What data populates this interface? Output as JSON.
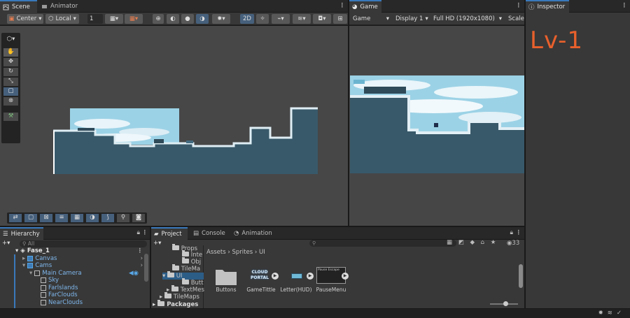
{
  "scene_window": {
    "tabs": [
      {
        "label": "Scene",
        "active": true
      },
      {
        "label": "Animator",
        "active": false
      }
    ],
    "toolbar": {
      "pivot": "Center",
      "space": "Local",
      "grid_value": "1",
      "mode_2d": "2D"
    }
  },
  "game_window": {
    "tab": "Game",
    "display_select": "Game",
    "display": "Display 1",
    "resolution": "Full HD (1920x1080)",
    "scale": "Scale"
  },
  "inspector": {
    "tab": "Inspector",
    "handwritten_note": "Lv-1"
  },
  "hierarchy": {
    "tab": "Hierarchy",
    "search_placeholder": "All",
    "items": [
      {
        "label": "Fase_1",
        "bold": true,
        "depth": 0,
        "icon": "unity-logo-icon"
      },
      {
        "label": "Canvas",
        "depth": 1,
        "icon": "prefab-icon"
      },
      {
        "label": "Cams",
        "depth": 1,
        "icon": "prefab-icon"
      },
      {
        "label": "Main Camera",
        "depth": 2,
        "icon": "gameobject-icon"
      },
      {
        "label": "Sky",
        "depth": 3,
        "icon": "gameobject-icon"
      },
      {
        "label": "Farlslands",
        "depth": 3,
        "icon": "gameobject-icon"
      },
      {
        "label": "FarClouds",
        "depth": 3,
        "icon": "gameobject-icon"
      },
      {
        "label": "NearClouds",
        "depth": 3,
        "icon": "gameobject-icon"
      }
    ]
  },
  "project": {
    "tabs": [
      {
        "label": "Project",
        "active": true
      },
      {
        "label": "Console",
        "active": false
      },
      {
        "label": "Animation",
        "active": false
      }
    ],
    "breadcrumb": [
      "Assets",
      "Sprites",
      "UI"
    ],
    "hidden_count": "33",
    "folders": [
      "Props",
      "Inte",
      "Obj",
      "TileMa",
      "UI",
      "Butt",
      "TextMes",
      "TileMaps",
      "Packages"
    ],
    "assets": [
      {
        "label": "Buttons",
        "kind": "folder"
      },
      {
        "label": "GameTittle",
        "kind": "sprite",
        "text": "CLOUD PORTAL"
      },
      {
        "label": "Letter(HUD)",
        "kind": "sprite"
      },
      {
        "label": "PauseMenu",
        "kind": "sprite",
        "text": "Pause Escape"
      }
    ]
  },
  "colors": {
    "accent": "#3a79bb",
    "panel": "#383838",
    "viewport": "#474747",
    "sky": "#9cd2e6",
    "ground": "#38596a",
    "handwriting": "#e8602c"
  }
}
